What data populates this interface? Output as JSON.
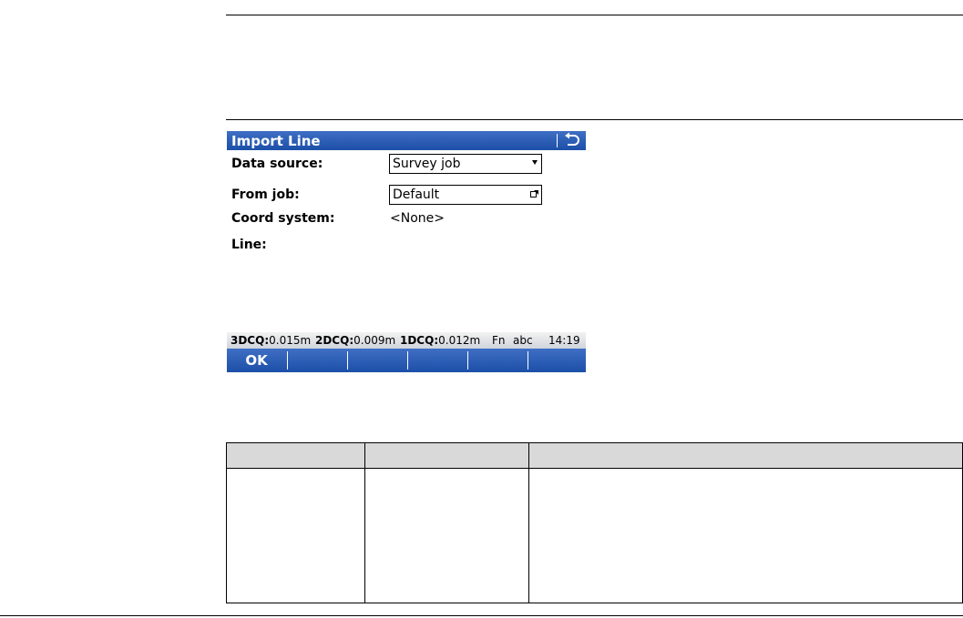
{
  "dialog": {
    "title": "Import Line",
    "back_icon": "back-arrow-icon",
    "fields": {
      "data_source": {
        "label": "Data source:",
        "value": "Survey job"
      },
      "from_job": {
        "label": "From job:",
        "value": "Default"
      },
      "coord_system": {
        "label": "Coord system:",
        "value": "<None>"
      },
      "line": {
        "label": "Line:"
      }
    }
  },
  "status": {
    "q3d_label": "3DCQ:",
    "q3d_value": "0.015m",
    "q2d_label": "2DCQ:",
    "q2d_value": "0.009m",
    "q1d_label": "1DCQ:",
    "q1d_value": "0.012m",
    "fn": "Fn",
    "input_mode": "abc",
    "time": "14:19"
  },
  "softkeys": [
    "OK",
    "",
    "",
    "",
    "",
    ""
  ],
  "colors": {
    "titlebar": "#1c4fa8",
    "table_header": "#d9d9d9"
  },
  "table": {
    "headers": [
      "",
      "",
      ""
    ],
    "rows": [
      [
        "",
        "",
        ""
      ]
    ]
  }
}
